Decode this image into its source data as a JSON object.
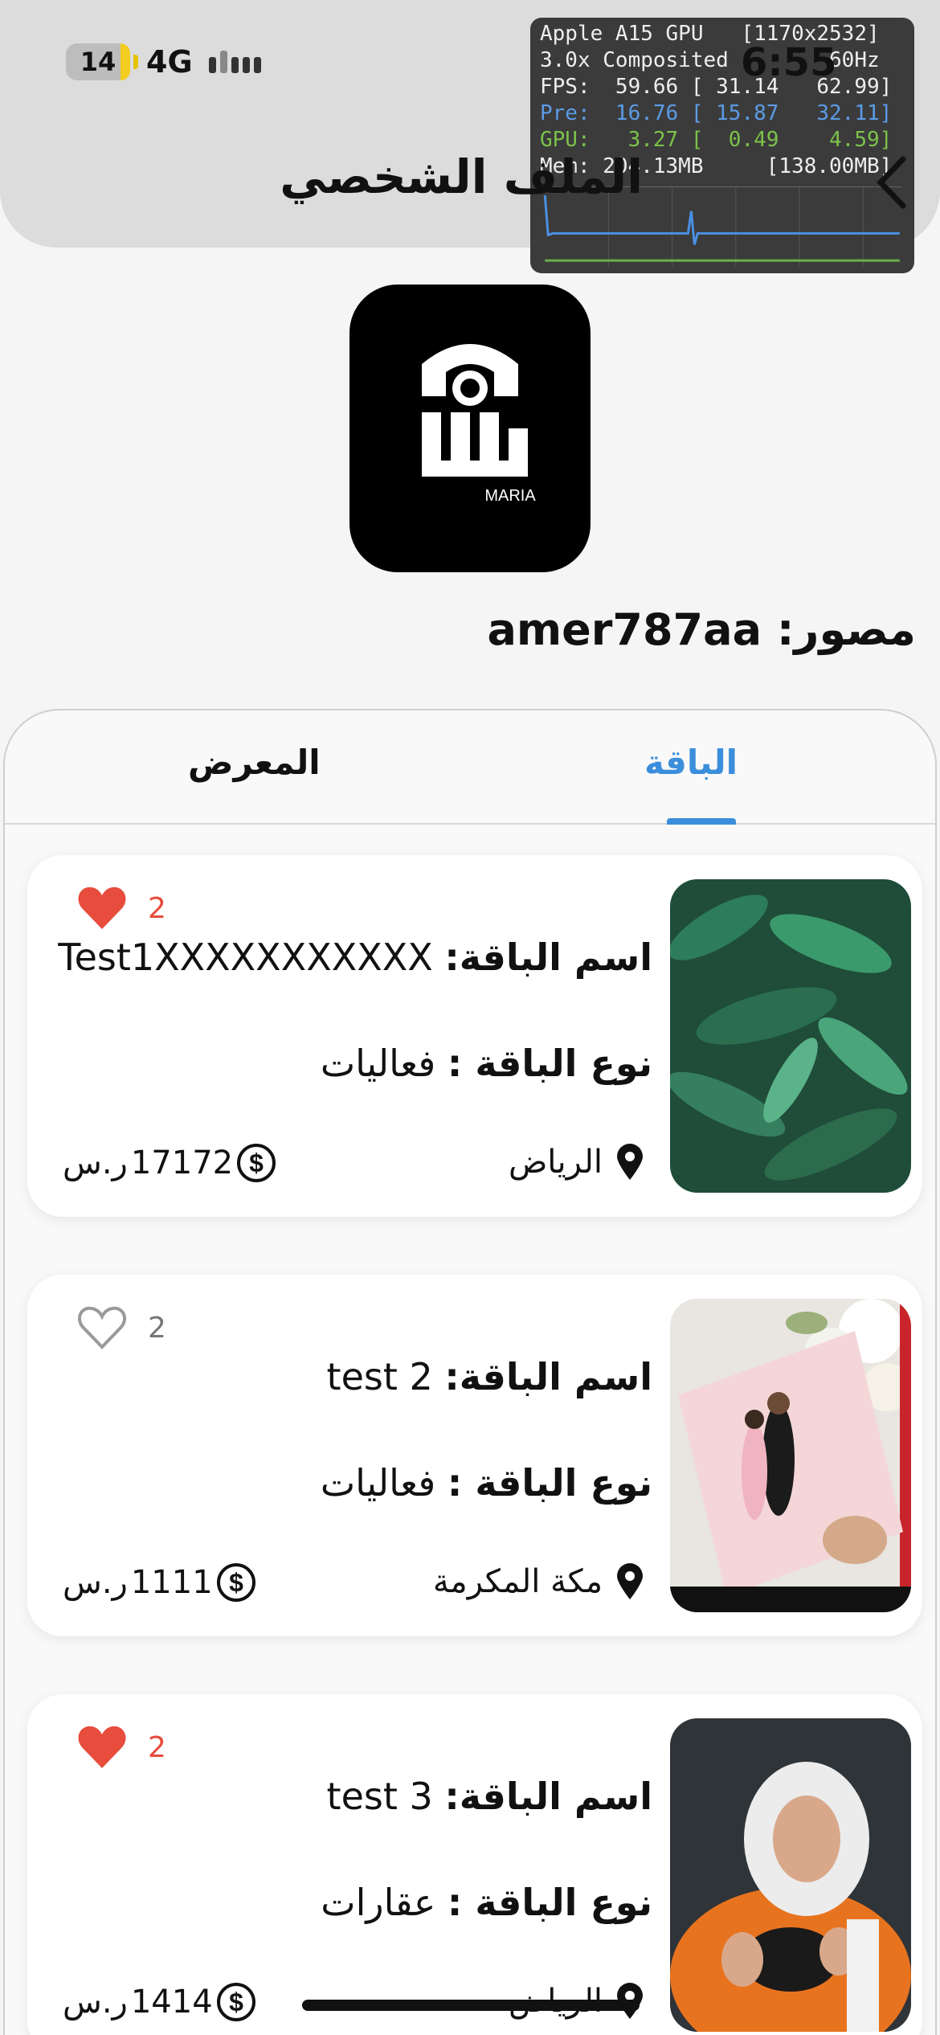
{
  "status_bar": {
    "battery": "14",
    "network": "4G",
    "time": "6:55"
  },
  "header": {
    "title": "الملف الشخصي",
    "back_icon": "chevron-left-icon"
  },
  "debug_overlay": {
    "lines": [
      "Apple A15 GPU   [1170x2532]",
      "3.0x Composited        60Hz",
      "FPS:  59.66 [ 31.14   62.99]",
      "Pre:  16.76 [ 15.87   32.11]",
      "GPU:   3.27 [  0.49    4.59]",
      "Mem: 204.13MB     [138.00MB]"
    ]
  },
  "profile": {
    "photographer": "مصور: amer787aa",
    "logo_text": "ماريا",
    "logo_sub": "MARIA"
  },
  "tabs": [
    {
      "label": "الباقة",
      "active": true
    },
    {
      "label": "المعرض",
      "active": false
    }
  ],
  "packages": [
    {
      "likes": "2",
      "liked": true,
      "name_label": "اسم الباقة:",
      "name": "Test1XXXXXXXXXXX…",
      "type_label": "نوع الباقة :",
      "type": "فعاليات",
      "location": "الرياض",
      "price": "17172",
      "currency": "ر.س",
      "image": "leaves"
    },
    {
      "likes": "2",
      "liked": false,
      "name_label": "اسم الباقة:",
      "name": "test 2",
      "type_label": "نوع الباقة :",
      "type": "فعاليات",
      "location": "مكة المكرمة",
      "price": "1111",
      "currency": "ر.س",
      "image": "card-photo"
    },
    {
      "likes": "2",
      "liked": true,
      "name_label": "اسم الباقة:",
      "name": "test 3",
      "type_label": "نوع الباقة :",
      "type": "عقارات",
      "location": "الرياض",
      "price": "1414",
      "currency": "ر.س",
      "image": "portrait"
    }
  ],
  "colors": {
    "accent": "#3b8edb",
    "like": "#e74c3c"
  }
}
